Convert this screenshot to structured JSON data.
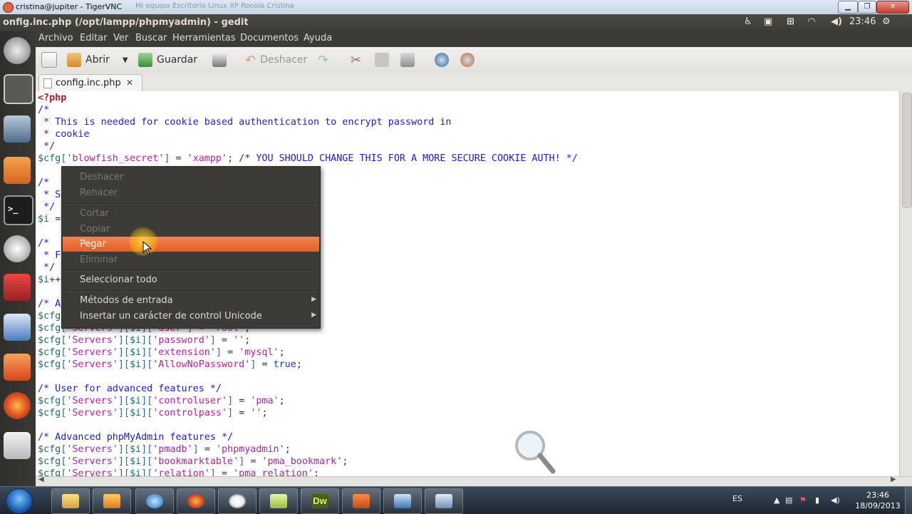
{
  "vnc": {
    "title": "cristina@jupiter - TigerVNC",
    "faded_title": "Mi equipo   Escritorio   Linux XP   Rocola Cristina"
  },
  "panel": {
    "title": "onfig.inc.php (/opt/lampp/phpmyadmin) - gedit",
    "time": "23:46"
  },
  "menubar": [
    "Archivo",
    "Editar",
    "Ver",
    "Buscar",
    "Herramientas",
    "Documentos",
    "Ayuda"
  ],
  "toolbar": {
    "open_label": "Abrir",
    "save_label": "Guardar",
    "undo_label": "Deshacer"
  },
  "tab": {
    "label": "config.inc.php",
    "close": "✕"
  },
  "context_menu": {
    "items": [
      {
        "label": "Deshacer",
        "enabled": false
      },
      {
        "label": "Rehacer",
        "enabled": false
      },
      {
        "label": "Cortar",
        "enabled": false
      },
      {
        "label": "Copiar",
        "enabled": false
      },
      {
        "label": "Pegar",
        "enabled": true,
        "highlighted": true
      },
      {
        "label": "Eliminar",
        "enabled": false
      },
      {
        "label": "Seleccionar todo",
        "enabled": true
      },
      {
        "label": "Métodos de entrada",
        "enabled": true,
        "submenu": true
      },
      {
        "label": "Insertar un carácter de control Unicode",
        "enabled": true,
        "submenu": true
      }
    ]
  },
  "code_lines": [
    "<?php",
    "/*",
    " * This is needed for cookie based authentication to encrypt password in",
    " * cookie",
    " */",
    "$cfg['blowfish_secret'] = 'xampp'; /* YOU SHOULD CHANGE THIS FOR A MORE SECURE COOKIE AUTH! */",
    "",
    "/*",
    " * S",
    " */",
    "$i =",
    "",
    "/*",
    " * F",
    " */",
    "$i++",
    "",
    "/* A",
    "$cfg",
    "$cfg['Servers'][$i]['user'] = 'root';",
    "$cfg['Servers'][$i]['password'] = '';",
    "$cfg['Servers'][$i]['extension'] = 'mysql';",
    "$cfg['Servers'][$i]['AllowNoPassword'] = true;",
    "",
    "/* User for advanced features */",
    "$cfg['Servers'][$i]['controluser'] = 'pma';",
    "$cfg['Servers'][$i]['controlpass'] = '';",
    "",
    "/* Advanced phpMyAdmin features */",
    "$cfg['Servers'][$i]['pmadb'] = 'phpmyadmin';",
    "$cfg['Servers'][$i]['bookmarktable'] = 'pma_bookmark';",
    "$cfg['Servers'][$i]['relation'] = 'pma_relation';"
  ],
  "taskbar": {
    "language": "ES",
    "time": "23:46",
    "date": "18/09/2013"
  },
  "colors": {
    "menu_highlight": "#e25f24",
    "panel_bg": "#3c3b37",
    "comment": "#2020c8",
    "string": "#b0239b"
  }
}
